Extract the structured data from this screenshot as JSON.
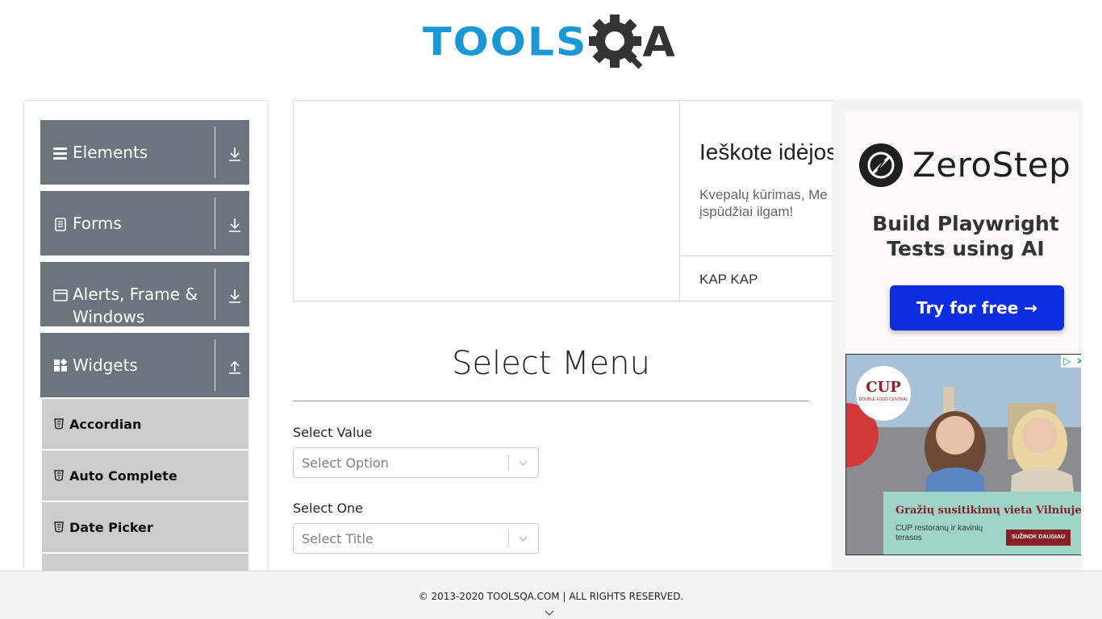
{
  "header": {
    "logo_tools": "TOOLS",
    "logo_a": "A",
    "logo_brand_color": "#1a97d5"
  },
  "sidebar": {
    "groups": [
      {
        "label": "Elements",
        "icon": "hamburger-icon",
        "state": "collapsed"
      },
      {
        "label": "Forms",
        "icon": "document-icon",
        "state": "collapsed"
      },
      {
        "label": "Alerts, Frame & Windows",
        "icon": "window-icon",
        "state": "collapsed"
      },
      {
        "label": "Widgets",
        "icon": "widgets-icon",
        "state": "expanded"
      }
    ],
    "items": [
      {
        "label": "Accordian",
        "icon": "html5-icon"
      },
      {
        "label": "Auto Complete",
        "icon": "html5-icon"
      },
      {
        "label": "Date Picker",
        "icon": "html5-icon"
      }
    ]
  },
  "ad_top": {
    "title": "Ieškote idėjos",
    "description_line1": "Kvepalų kūrimas, Me",
    "description_line2": "įspūdžiai ilgam!",
    "brand": "KAP KAP"
  },
  "ad_right": {
    "zerostep": {
      "name": "ZeroStep",
      "tagline_line1": "Build Playwright",
      "tagline_line2": "Tests using AI",
      "button": "Try for free →",
      "button_color": "#0d2ee0"
    },
    "cup": {
      "logo": "CUP",
      "logo_sub": "DOUBLE FOOD CENTRAL",
      "headline": "Gražių susitikimų vieta Vilniuje",
      "sub": "CUP restoranų ir kavinių terasos",
      "button": "SUŽINOK DAUGIAU",
      "ad_choices": "▷",
      "close": "✕"
    }
  },
  "main": {
    "title": "Select Menu",
    "fields": [
      {
        "label": "Select Value",
        "placeholder": "Select Option"
      },
      {
        "label": "Select One",
        "placeholder": "Select Title"
      }
    ]
  },
  "footer": {
    "text": "© 2013-2020 TOOLSQA.COM | ALL RIGHTS RESERVED."
  }
}
